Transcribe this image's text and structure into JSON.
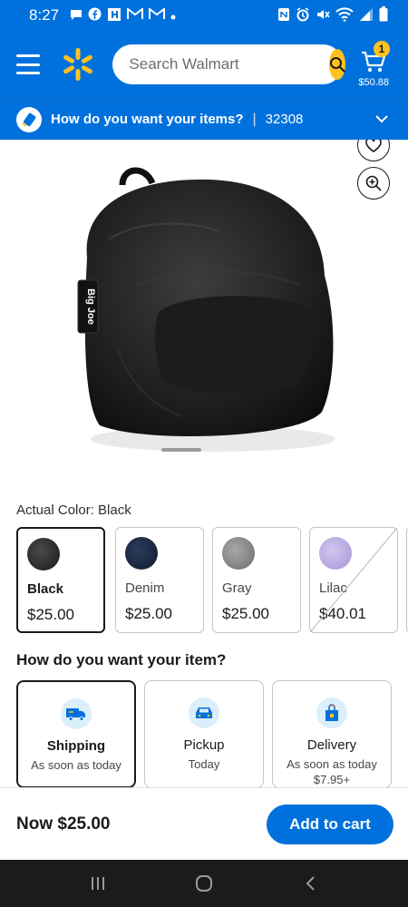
{
  "status_bar": {
    "time": "8:27",
    "left_icons": [
      "chat-icon",
      "facebook-icon",
      "news-icon",
      "gmail-icon",
      "gmail-icon",
      "dot-icon"
    ],
    "right_icons": [
      "nfc-icon",
      "alarm-icon",
      "mute-icon",
      "wifi-icon",
      "signal-icon",
      "battery-icon"
    ]
  },
  "header": {
    "search_placeholder": "Search Walmart",
    "cart_count": "1",
    "cart_total": "$50.88"
  },
  "fulfillment_bar": {
    "prompt": "How do you want your items?",
    "zip": "32308"
  },
  "product": {
    "image_label": "Big Joe",
    "actual_color_prefix": "Actual Color:",
    "actual_color": "Black",
    "colors": [
      {
        "name": "Black",
        "price": "$25.00",
        "swatch": "#2a2a2a",
        "selected": true,
        "out_of_stock": false
      },
      {
        "name": "Denim",
        "price": "$25.00",
        "swatch": "#1b2840",
        "selected": false,
        "out_of_stock": false
      },
      {
        "name": "Gray",
        "price": "$25.00",
        "swatch": "#8a8a8a",
        "selected": false,
        "out_of_stock": false
      },
      {
        "name": "Lilac",
        "price": "$40.01",
        "swatch": "#b9abe0",
        "selected": false,
        "out_of_stock": true
      }
    ]
  },
  "fulfillment_options": {
    "title": "How do you want your item?",
    "options": [
      {
        "title": "Shipping",
        "subtitle": "As soon as today",
        "icon": "truck-icon",
        "selected": true
      },
      {
        "title": "Pickup",
        "subtitle": "Today",
        "icon": "car-icon",
        "selected": false
      },
      {
        "title": "Delivery",
        "subtitle": "As soon as today",
        "fee": "$7.95+",
        "icon": "bag-icon",
        "selected": false
      }
    ]
  },
  "bottom_bar": {
    "price_label": "Now $25.00",
    "add_to_cart": "Add to cart"
  },
  "colors": {
    "brand_blue": "#0071dc",
    "spark_yellow": "#ffc220"
  }
}
